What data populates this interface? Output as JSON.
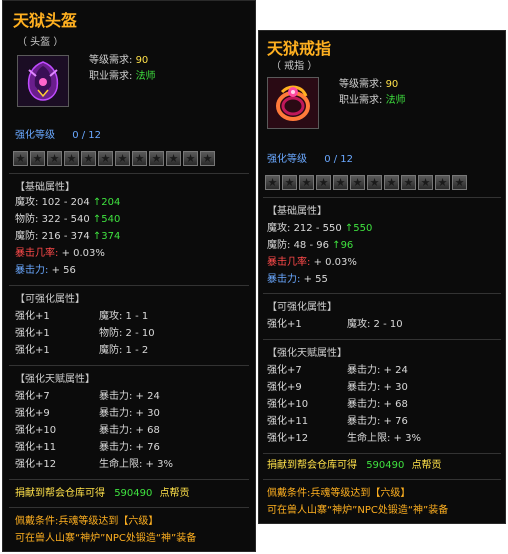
{
  "items": [
    {
      "name": "天狱头盔",
      "type": "（ 头盔 ）",
      "icon": "helmet-icon",
      "level_req_label": "等级需求:",
      "level_req": "90",
      "class_req_label": "职业需求:",
      "class_req": "法师",
      "enhance_label": "强化等级",
      "enhance_value": "0 / 12",
      "star_count": 12,
      "base_header": "【基础属性】",
      "base": [
        {
          "label": "魔攻:",
          "range": "102 - 204",
          "bonus": "204"
        },
        {
          "label": "物防:",
          "range": "322 - 540",
          "bonus": "540"
        },
        {
          "label": "魔防:",
          "range": "216 - 374",
          "bonus": "374"
        }
      ],
      "crit_rate_label": "暴击几率:",
      "crit_rate": "+ 0.03%",
      "crit_power_label": "暴击力:",
      "crit_power": "+ 56",
      "enh_header": "【可强化属性】",
      "enh": [
        {
          "lvl": "强化+1",
          "attr": "魔攻: 1 - 1"
        },
        {
          "lvl": "强化+1",
          "attr": "物防: 2 - 10"
        },
        {
          "lvl": "强化+1",
          "attr": "魔防: 1 - 2"
        }
      ],
      "talent_header": "【强化天赋属性】",
      "talent": [
        {
          "lvl": "强化+7",
          "attr": "暴击力: + 24"
        },
        {
          "lvl": "强化+9",
          "attr": "暴击力: + 30"
        },
        {
          "lvl": "强化+10",
          "attr": "暴击力: + 68"
        },
        {
          "lvl": "强化+11",
          "attr": "暴击力: + 76"
        },
        {
          "lvl": "强化+12",
          "attr": "生命上限: + 3%"
        }
      ],
      "donate_label": "捐献到帮会仓库可得",
      "donate_value": "590490",
      "donate_unit": "点帮贡",
      "equip_cond": "佩戴条件:兵魂等级达到【六级】",
      "forge_note": "可在兽人山寨“神炉”NPC处锻造“神”装备"
    },
    {
      "name": "天狱戒指",
      "type": "（ 戒指 ）",
      "icon": "ring-icon",
      "level_req_label": "等级需求:",
      "level_req": "90",
      "class_req_label": "职业需求:",
      "class_req": "法师",
      "enhance_label": "强化等级",
      "enhance_value": "0 / 12",
      "star_count": 12,
      "base_header": "【基础属性】",
      "base": [
        {
          "label": "魔攻:",
          "range": "212 - 550",
          "bonus": "550"
        },
        {
          "label": "魔防:",
          "range": "48 - 96",
          "bonus": "96"
        }
      ],
      "crit_rate_label": "暴击几率:",
      "crit_rate": "+ 0.03%",
      "crit_power_label": "暴击力:",
      "crit_power": "+ 55",
      "enh_header": "【可强化属性】",
      "enh": [
        {
          "lvl": "强化+1",
          "attr": "魔攻: 2 - 10"
        }
      ],
      "talent_header": "【强化天赋属性】",
      "talent": [
        {
          "lvl": "强化+7",
          "attr": "暴击力: + 24"
        },
        {
          "lvl": "强化+9",
          "attr": "暴击力: + 30"
        },
        {
          "lvl": "强化+10",
          "attr": "暴击力: + 68"
        },
        {
          "lvl": "强化+11",
          "attr": "暴击力: + 76"
        },
        {
          "lvl": "强化+12",
          "attr": "生命上限: + 3%"
        }
      ],
      "donate_label": "捐献到帮会仓库可得",
      "donate_value": "590490",
      "donate_unit": "点帮贡",
      "equip_cond": "佩戴条件:兵魂等级达到【六级】",
      "forge_note": "可在兽人山寨“神炉”NPC处锻造“神”装备"
    }
  ],
  "colors": {
    "title": "#ffb020",
    "blue": "#6aa8ff",
    "green": "#3fe23f",
    "red": "#ff4a4a",
    "yellow": "#ffe14a"
  }
}
